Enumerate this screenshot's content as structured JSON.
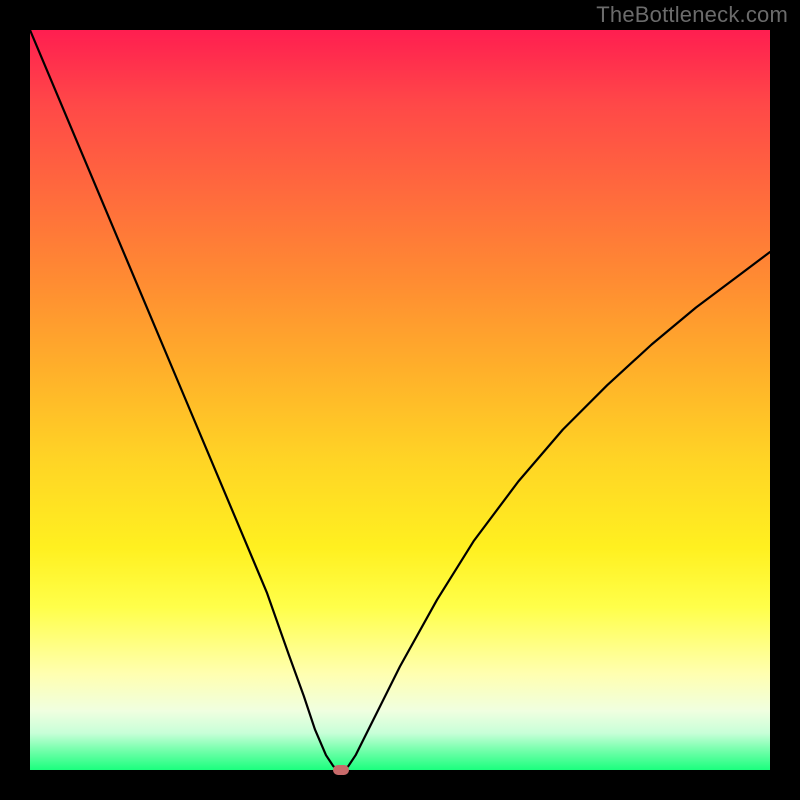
{
  "watermark": "TheBottleneck.com",
  "colors": {
    "curve_stroke": "#000000",
    "marker_fill": "#c86a6a",
    "frame_bg": "#000000"
  },
  "chart_data": {
    "type": "line",
    "title": "",
    "xlabel": "",
    "ylabel": "",
    "xlim": [
      0,
      100
    ],
    "ylim": [
      0,
      100
    ],
    "x": [
      0,
      4,
      8,
      12,
      16,
      20,
      24,
      28,
      32,
      35,
      37,
      38.5,
      40,
      41,
      42,
      43,
      44,
      46,
      50,
      55,
      60,
      66,
      72,
      78,
      84,
      90,
      96,
      100
    ],
    "values": [
      100,
      90.5,
      81,
      71.5,
      62,
      52.5,
      43,
      33.5,
      24,
      15.5,
      10,
      5.5,
      2,
      0.5,
      0,
      0.5,
      2,
      6,
      14,
      23,
      31,
      39,
      46,
      52,
      57.5,
      62.5,
      67,
      70
    ],
    "min_point": {
      "x": 42,
      "y": 0
    },
    "flat_bottom": {
      "x_start": 38.5,
      "x_end": 44
    }
  }
}
